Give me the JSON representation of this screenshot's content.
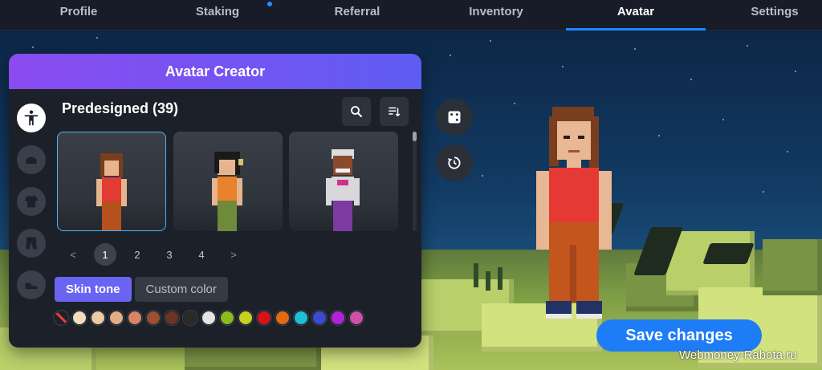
{
  "nav": {
    "tabs": [
      {
        "label": "Profile"
      },
      {
        "label": "Staking"
      },
      {
        "label": "Referral"
      },
      {
        "label": "Inventory"
      },
      {
        "label": "Avatar"
      },
      {
        "label": "Settings"
      }
    ],
    "active_tab": "Avatar"
  },
  "panel": {
    "title": "Avatar Creator",
    "section_title": "Predesigned (39)",
    "categories": [
      "body-icon",
      "head-icon",
      "shirt-icon",
      "pants-icon",
      "shoe-icon"
    ],
    "cards": [
      {
        "avatar": "red-shirt-brown-hair",
        "selected": true
      },
      {
        "avatar": "orange-shirt-dark-hair",
        "selected": false
      },
      {
        "avatar": "white-hair-dark-skin",
        "selected": false
      }
    ],
    "pagination": {
      "prev": "<",
      "pages": [
        "1",
        "2",
        "3",
        "4"
      ],
      "current": "1",
      "next": ">"
    },
    "tone_tabs": {
      "skin_tone": "Skin tone",
      "custom_color": "Custom color",
      "active": "Skin tone"
    },
    "swatches": [
      "none",
      "#f4dcc0",
      "#eec9a5",
      "#e3ad86",
      "#d98464",
      "#9b5131",
      "#6a3521",
      "#2c2a25",
      "#e2e4e8",
      "#8bbb1e",
      "#c7d11f",
      "#d8121a",
      "#e36a13",
      "#1dbfd6",
      "#3b4cd0",
      "#b322d9",
      "#d14fa6"
    ]
  },
  "side_buttons": [
    "dice-icon",
    "history-icon"
  ],
  "save_button": "Save changes",
  "watermark": "Webmoney-Rabota.ru",
  "colors": {
    "accent": "#1e88ff",
    "header_gradient_start": "#8b4cf0",
    "header_gradient_end": "#5f5cf3",
    "active_tab": "#6a64f3"
  }
}
